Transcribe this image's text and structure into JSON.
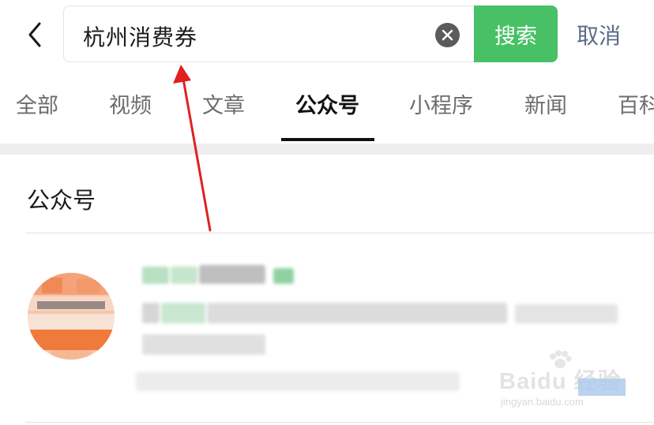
{
  "search": {
    "query": "杭州消费券",
    "button_label": "搜索",
    "cancel_label": "取消"
  },
  "tabs": [
    {
      "label": "全部"
    },
    {
      "label": "视频"
    },
    {
      "label": "文章"
    },
    {
      "label": "公众号",
      "active": true
    },
    {
      "label": "小程序"
    },
    {
      "label": "新闻"
    },
    {
      "label": "百科"
    }
  ],
  "section": {
    "title": "公众号"
  },
  "watermark": {
    "brand": "Baidu 经验",
    "url": "jingyan.baidu.com"
  },
  "colors": {
    "accent_green": "#47c066",
    "cancel_text": "#5a6b86",
    "annotation_red": "#e02020"
  }
}
